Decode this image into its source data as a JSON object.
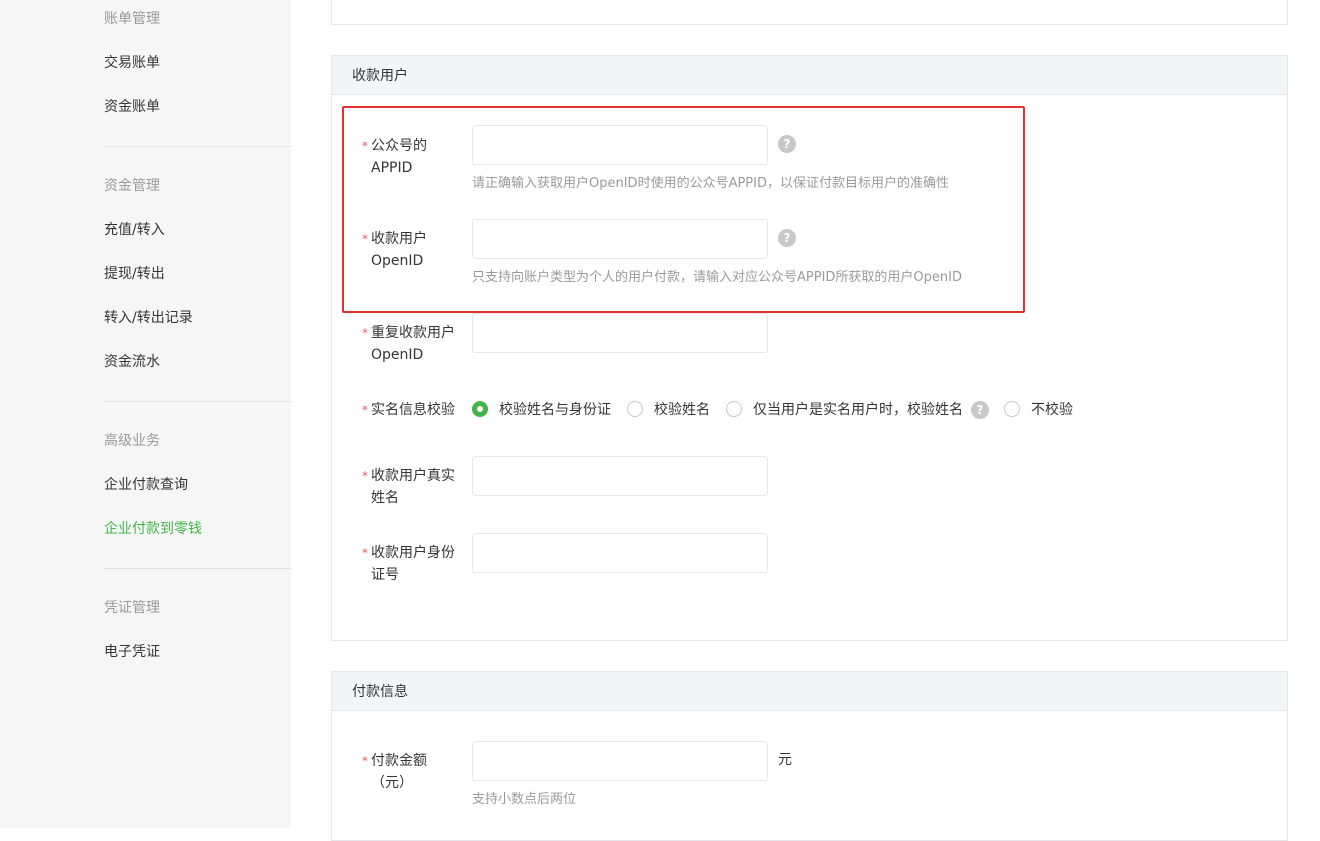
{
  "sidebar": {
    "groups": [
      {
        "title": "账单管理",
        "items": [
          {
            "label": "交易账单"
          },
          {
            "label": "资金账单"
          }
        ]
      },
      {
        "title": "资金管理",
        "items": [
          {
            "label": "充值/转入"
          },
          {
            "label": "提现/转出"
          },
          {
            "label": "转入/转出记录"
          },
          {
            "label": "资金流水"
          }
        ]
      },
      {
        "title": "高级业务",
        "items": [
          {
            "label": "企业付款查询"
          },
          {
            "label": "企业付款到零钱",
            "active": true
          }
        ]
      },
      {
        "title": "凭证管理",
        "items": [
          {
            "label": "电子凭证"
          }
        ]
      }
    ]
  },
  "receiver_section": {
    "title": "收款用户",
    "appid": {
      "label": "公众号的APPID",
      "value": "",
      "tip": "请正确输入获取用户OpenID时使用的公众号APPID，以保证付款目标用户的准确性"
    },
    "openid": {
      "label": "收款用户OpenID",
      "value": "",
      "tip": "只支持向账户类型为个人的用户付款，请输入对应公众号APPID所获取的用户OpenID"
    },
    "repeat_openid": {
      "label": "重复收款用户OpenID",
      "value": ""
    },
    "realname_check": {
      "label": "实名信息校验",
      "options": [
        {
          "label": "校验姓名与身份证",
          "checked": true
        },
        {
          "label": "校验姓名",
          "checked": false
        },
        {
          "label": "仅当用户是实名用户时，校验姓名",
          "checked": false
        },
        {
          "label": "不校验",
          "checked": false
        }
      ]
    },
    "real_name": {
      "label": "收款用户真实姓名",
      "value": ""
    },
    "id_number": {
      "label": "收款用户身份证号",
      "value": ""
    }
  },
  "payment_section": {
    "title": "付款信息",
    "amount": {
      "label": "付款金额（元）",
      "value": "",
      "unit": "元",
      "tip": "支持小数点后两位"
    }
  },
  "required_mark": "*",
  "help_glyph": "?",
  "colors": {
    "accent_green": "#44b549",
    "required_red": "#e15f63",
    "highlight_red": "#e5302f"
  }
}
